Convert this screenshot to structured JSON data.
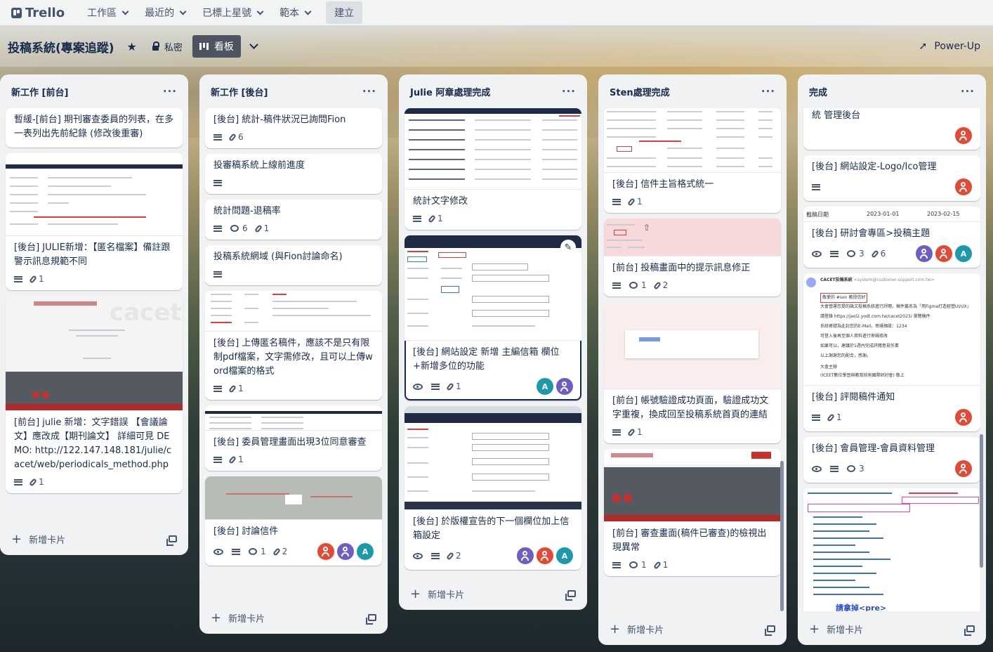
{
  "nav": {
    "brand": "Trello",
    "workspace": "工作區",
    "recent": "最近的",
    "starred": "已標上星號",
    "templates": "範本",
    "create": "建立"
  },
  "board": {
    "title": "投稿系統(專案追蹤)",
    "visibility": "私密",
    "view": "看板",
    "powerup": "Power-Up"
  },
  "add_card_label": "新增卡片",
  "lists": [
    {
      "name": "新工作 [前台]",
      "cards": [
        {
          "title": "暫緩-[前台] 期刊審查委員的列表，在多一表列出先前紀錄 (修改後重審)",
          "badges": []
        },
        {
          "title": "[後台] JULIE新增：【匿名檔案】備註跟警示訊息規範不同",
          "desc": true,
          "attachments": "1"
        },
        {
          "title": "[前台] julie 新增：文字錯誤 【會議論文】應改成【期刊論文】 詳細可見 DEMO: http://122.147.148.181/julie/cacet/web/periodicals_method.php",
          "desc": true,
          "attachments": "1"
        }
      ]
    },
    {
      "name": "新工作 [後台]",
      "cards": [
        {
          "title": "[後台] 統計-稿件狀況已詢問Fion",
          "desc": true,
          "attachments": "6"
        },
        {
          "title": "投審稿系統上線前進度",
          "desc": true
        },
        {
          "title": "統計問題-退稿率",
          "desc": true,
          "comments": "6",
          "attachments": "1"
        },
        {
          "title": "投稿系統網域 (與Fion討論命名)",
          "desc": true
        },
        {
          "title": "[後台] 上傳匿名稿件，應該不是只有限制pdf檔案，文字需修改，且可以上傳word檔案的格式",
          "desc": true,
          "attachments": "1"
        },
        {
          "title": "[後台] 委員管理畫面出現3位同意審查",
          "desc": true,
          "attachments": "1"
        },
        {
          "title": "[後台] 討論信件",
          "watch": true,
          "desc": true,
          "comments": "1",
          "attachments": "2",
          "avatars": [
            "orange",
            "purple",
            "A"
          ]
        }
      ]
    },
    {
      "name": "Julie 阿章處理完成",
      "cards": [
        {
          "title": "統計文字修改",
          "desc": true,
          "attachments": "1"
        },
        {
          "title": "[後台] 網站設定 新增 主編信箱 欄位+新增多位的功能",
          "watch": true,
          "desc": true,
          "attachments": "1",
          "avatars": [
            "A",
            "purple"
          ]
        },
        {
          "title": "[後台] 於版權宣告的下一個欄位加上信箱設定",
          "watch": true,
          "desc": true,
          "attachments": "2",
          "avatars": [
            "purple",
            "orange",
            "A"
          ]
        }
      ]
    },
    {
      "name": "Sten處理完成",
      "cards": [
        {
          "title": "[後台] 信件主旨格式統一",
          "desc": true,
          "attachments": "1"
        },
        {
          "title": "[前台] 投稿畫面中的提示訊息修正",
          "desc": true,
          "comments": "1",
          "attachments": "2"
        },
        {
          "title": "[前台] 帳號驗證成功頁面，驗證成功文字重複，換成回至投稿系統首頁的連結",
          "desc": true,
          "attachments": "1"
        },
        {
          "title": "[前台] 審查畫面(稿件已審查)的檢視出現異常",
          "desc": true,
          "comments": "1",
          "attachments": "1"
        }
      ]
    },
    {
      "name": "完成",
      "cards": [
        {
          "title": "統 管理後台",
          "avatars": [
            "orange"
          ]
        },
        {
          "title": "[後台] 網站設定-Logo/Ico管理",
          "desc": true,
          "avatars": [
            "orange"
          ]
        },
        {
          "title": "[後台] 研討會專區>投稿主題",
          "watch": true,
          "desc": true,
          "comments": "3",
          "attachments": "6",
          "avatars": [
            "purple",
            "orange",
            "A"
          ]
        },
        {
          "title": "[後台] 評閱稿件通知",
          "desc": true,
          "attachments": "1",
          "avatars": [
            "orange"
          ]
        },
        {
          "title": "[後台] 會員管理-會員資料管理",
          "watch": true,
          "desc": true,
          "comments": "3",
          "avatars": [
            "orange"
          ]
        }
      ]
    }
  ],
  "covers": {
    "cacet_logo_word": "cacet",
    "sten_field_date_label": "截稿日期",
    "sten_field_date_from": "2023-01-01",
    "sten_field_date_to": "2023-02-15",
    "done_code_caption": "請拿掉<pre>",
    "email_sender": "CACET投稿系統",
    "email_sender_address": "<system@customer-support.com.tw>",
    "email_line_1": "敬愛的 #son 教授您好",
    "email_line_2": "大會營運您提的論文投稿系統進行評閱，稿件篇名為「用Figma打造經營UI/UX」",
    "email_line_3": "請登錄 https://jaol2.yodt.com.tw/cacet2023/ 瀏覽稿件",
    "email_line_4": "系統帳號為此封您的E-Mail，密碼預設：1234",
    "email_line_5": "可登入後再至個人資料進行密碼修改",
    "email_line_6": "如果可以，建議於1週內完成評閱意見作業",
    "email_line_7": "以上謝謝您的配合，感謝。",
    "email_sign_1": "大會主辦",
    "email_sign_2": "(ICEET數位學習與教育技術國際研討會) 敬上"
  }
}
